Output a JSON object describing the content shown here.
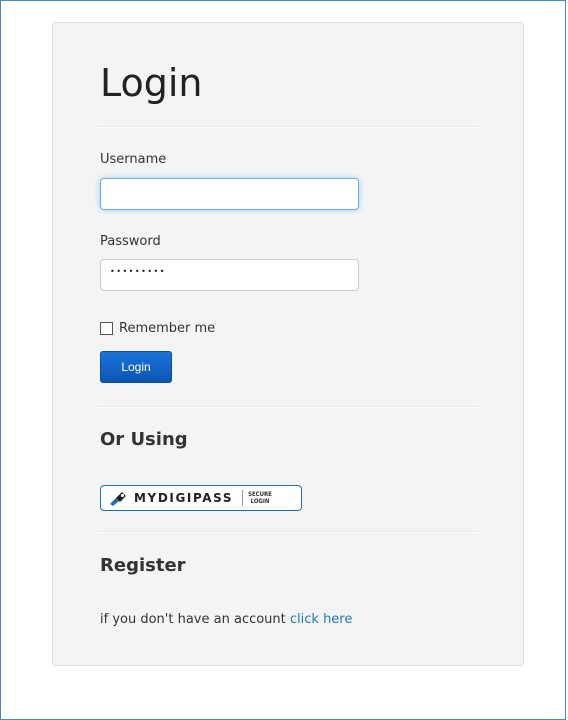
{
  "login": {
    "title": "Login",
    "username_label": "Username",
    "username_value": "",
    "password_label": "Password",
    "password_masked": "•••••••••",
    "remember_label": "Remember me",
    "remember_checked": false,
    "submit_label": "Login"
  },
  "alt_login": {
    "title": "Or Using",
    "provider_label": "MYDIGIPASS",
    "provider_badge_line1": "SECURE",
    "provider_badge_line2": "LOGIN",
    "provider_icon": "key-icon"
  },
  "register": {
    "title": "Register",
    "prompt": "if you don't have an account ",
    "link_label": "click here"
  },
  "colors": {
    "accent": "#0c55b4",
    "link": "#1a7bbf",
    "focus_glow": "#66afe9",
    "panel_bg": "#f4f4f4",
    "frame_border": "#4a86c5"
  }
}
